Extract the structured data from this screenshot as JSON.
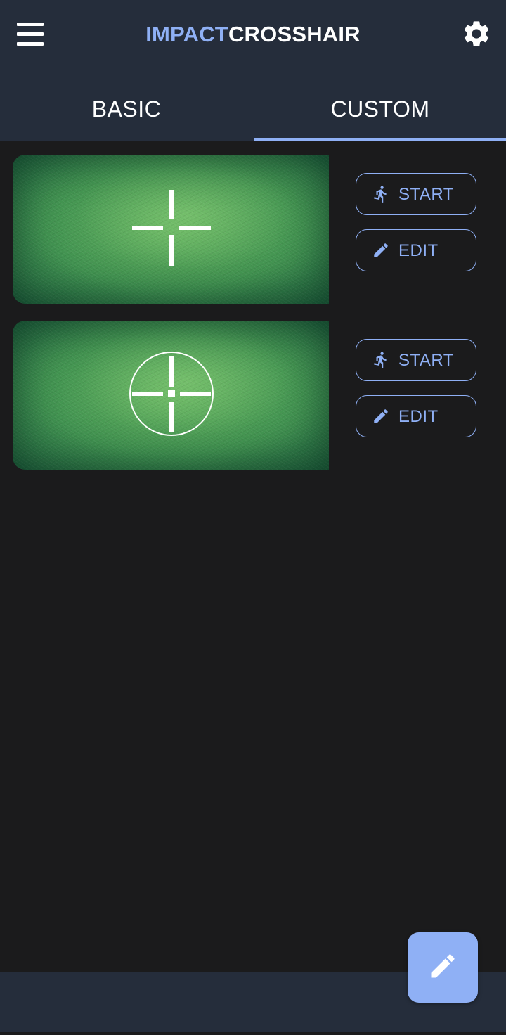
{
  "app": {
    "title_part1": "IMPACT",
    "title_part2": "CROSSHAIR"
  },
  "header": {
    "menu_icon": "menu-icon",
    "settings_icon": "gear-icon"
  },
  "tabs": [
    {
      "label": "BASIC",
      "active": false
    },
    {
      "label": "CUSTOM",
      "active": true
    }
  ],
  "cards": [
    {
      "crosshair": "cross",
      "start_label": "START",
      "edit_label": "EDIT",
      "start_icon": "running-person-icon",
      "edit_icon": "pencil-icon"
    },
    {
      "crosshair": "circle-cross",
      "start_label": "START",
      "edit_label": "EDIT",
      "start_icon": "running-person-icon",
      "edit_icon": "pencil-icon"
    }
  ],
  "fab": {
    "icon": "pencil-icon"
  },
  "colors": {
    "accent": "#8fb0f5",
    "header_bg": "#252d3b",
    "body_bg": "#1b1b1c",
    "text": "#ffffff"
  }
}
